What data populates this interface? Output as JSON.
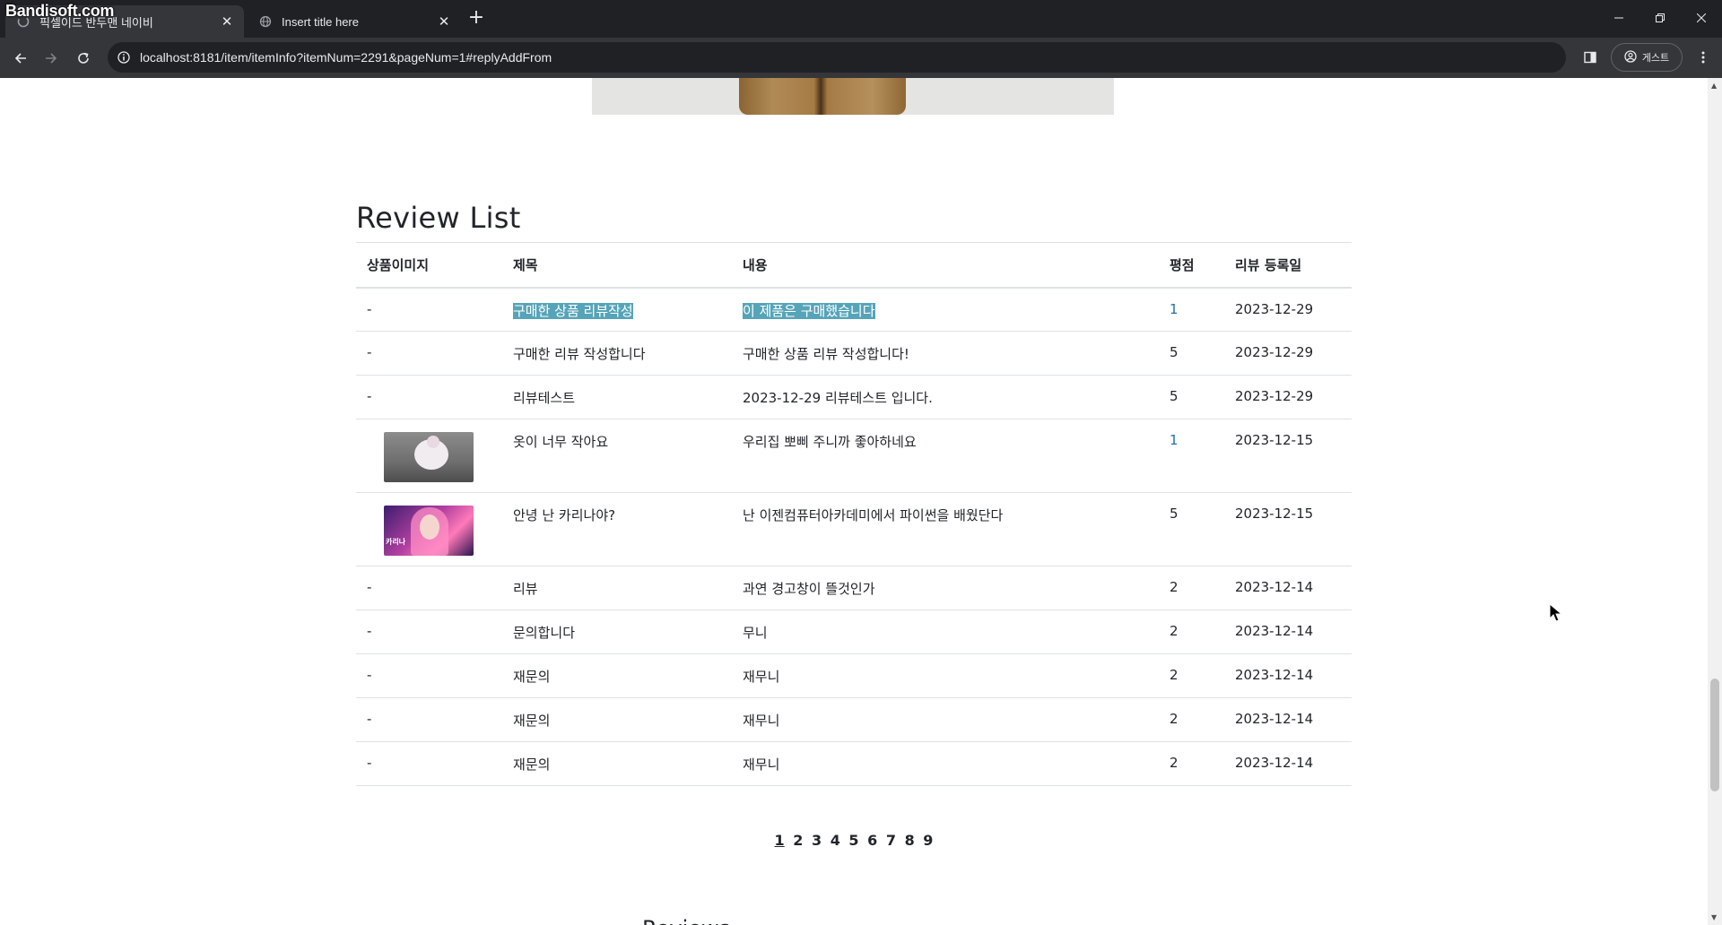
{
  "browser": {
    "watermark": "Bandisoft.com",
    "tabs": [
      {
        "title": "픽셀이드 반두맨 네이비",
        "active": true,
        "close": "✕"
      },
      {
        "title": "Insert title here",
        "active": false,
        "close": "✕"
      }
    ],
    "new_tab": "+",
    "url": "localhost:8181/item/itemInfo?itemNum=2291&pageNum=1#replyAddFrom",
    "profile_label": "게스트",
    "window_controls": [
      "minimize",
      "restore",
      "close"
    ]
  },
  "page": {
    "review_title": "Review List",
    "columns": [
      "상품이미지",
      "제목",
      "내용",
      "평점",
      "리뷰 등록일"
    ],
    "rows": [
      {
        "image": "-",
        "title": "구매한 상품 리뷰작성",
        "content": "이 제품은 구매했습니다",
        "rating": "1",
        "date": "2023-12-29"
      },
      {
        "image": "-",
        "title": "구매한 리뷰 작성합니다",
        "content": "구매한 상품 리뷰 작성합니다!",
        "rating": "5",
        "date": "2023-12-29"
      },
      {
        "image": "-",
        "title": "리뷰테스트",
        "content": "2023-12-29 리뷰테스트 입니다.",
        "rating": "5",
        "date": "2023-12-29"
      },
      {
        "image": "dog-thumbnail",
        "title": "옷이 너무 작아요",
        "content": "우리집 뽀삐 주니까 좋아하네요",
        "rating": "1",
        "date": "2023-12-15"
      },
      {
        "image": "idol-thumbnail",
        "image_caption": "카리나",
        "title": "안녕 난 카리나야?",
        "content": "난 이젠컴퓨터아카데미에서 파이썬을 배웠단다",
        "rating": "5",
        "date": "2023-12-15"
      },
      {
        "image": "-",
        "title": "리뷰",
        "content": "과연 경고창이 뜰것인가",
        "rating": "2",
        "date": "2023-12-14"
      },
      {
        "image": "-",
        "title": "문의합니다",
        "content": "무니",
        "rating": "2",
        "date": "2023-12-14"
      },
      {
        "image": "-",
        "title": "재문의",
        "content": "재무니",
        "rating": "2",
        "date": "2023-12-14"
      },
      {
        "image": "-",
        "title": "재문의",
        "content": "재무니",
        "rating": "2",
        "date": "2023-12-14"
      },
      {
        "image": "-",
        "title": "재문의",
        "content": "재무니",
        "rating": "2",
        "date": "2023-12-14"
      }
    ],
    "pagination": [
      "1",
      "2",
      "3",
      "4",
      "5",
      "6",
      "7",
      "8",
      "9"
    ],
    "current_page": "1",
    "next_heading_partial": "Reviews"
  },
  "colors": {
    "tab_bar": "#202124",
    "toolbar": "#35363a",
    "highlight": "#56a4b8",
    "link": "#1f6fb2"
  }
}
